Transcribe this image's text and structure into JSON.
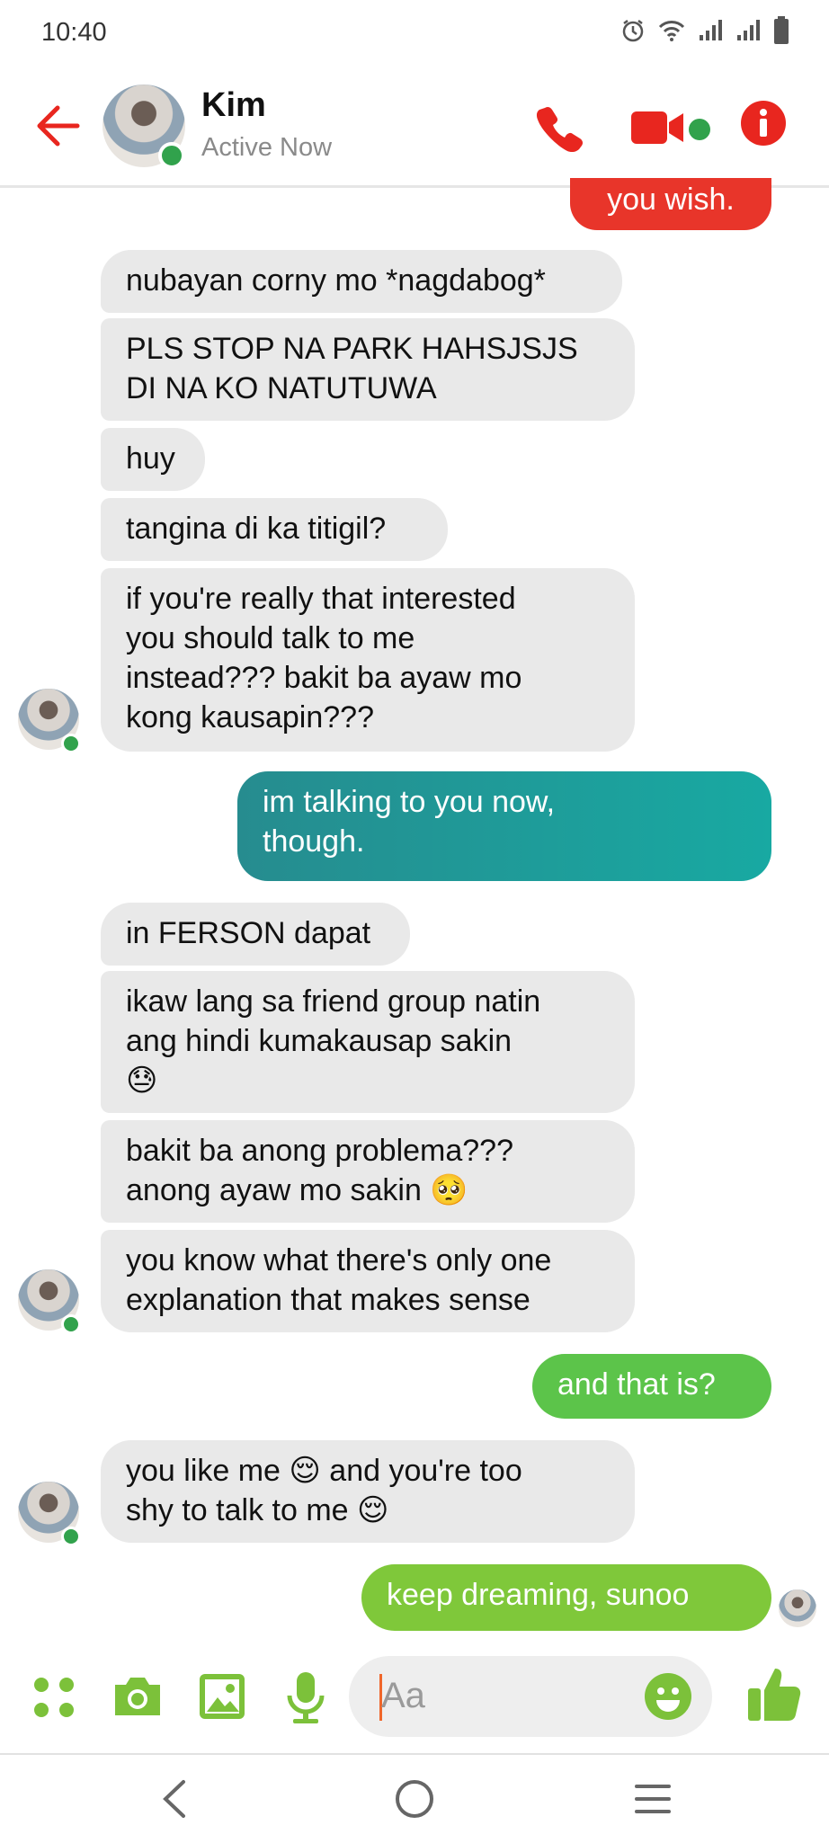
{
  "status_bar": {
    "time": "10:40"
  },
  "header": {
    "name": "Kim",
    "status": "Active Now"
  },
  "messages": {
    "m0": "you wish.",
    "m1": "nubayan corny mo *nagdabog*",
    "m2": "PLS STOP NA PARK HAHSJSJS\nDI NA KO NATUTUWA",
    "m3": "huy",
    "m4": "tangina di ka titigil?",
    "m5": "if you're really that interested\nyou should talk to me\ninstead??? bakit ba ayaw mo\nkong kausapin???",
    "m6": "im talking to you now,\nthough.",
    "m7": "in FERSON dapat",
    "m8": "ikaw lang sa friend group natin\nang hindi kumakausap sakin\n😓",
    "m9": "bakit ba anong problema???\nanong ayaw mo sakin 🥺",
    "m10": "you know what there's only one\nexplanation that makes sense",
    "m11": "and that is?",
    "m12": "you like me 😌 and you're too\nshy to talk to me 😌",
    "m13": "keep dreaming, sunoo"
  },
  "composer": {
    "placeholder": "Aa"
  },
  "colors": {
    "accent_red": "#e8261f",
    "sent_red": "#e8352a",
    "sent_teal": "#1fa19f",
    "sent_green": "#5cc44a",
    "sent_lime": "#7fc83a",
    "composer_green": "#7cc13a",
    "received_bg": "#e9e9e9"
  },
  "icons": {
    "back": "arrow-left-icon",
    "call": "phone-icon",
    "video": "video-camera-icon",
    "info": "info-icon",
    "apps": "apps-grid-icon",
    "camera": "camera-icon",
    "gallery": "image-icon",
    "mic": "microphone-icon",
    "emoji": "smiley-icon",
    "like": "thumbs-up-icon"
  }
}
